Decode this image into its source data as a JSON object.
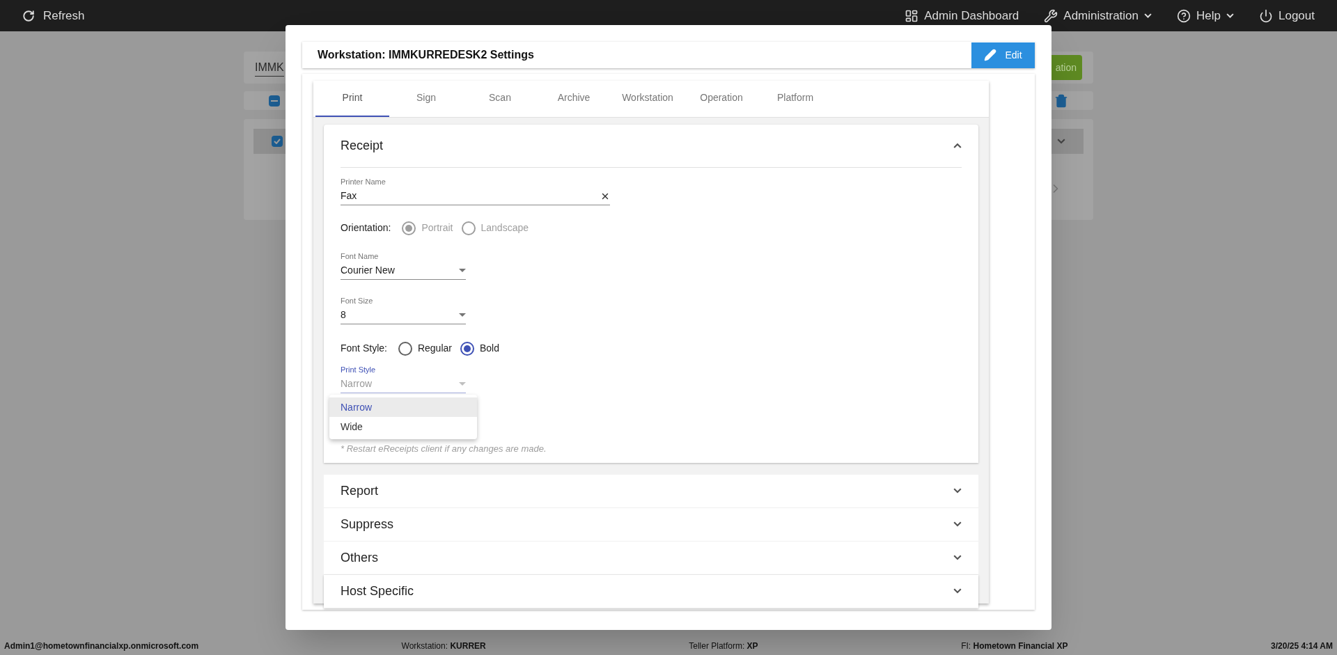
{
  "top_bar": {
    "refresh": "Refresh",
    "items": [
      {
        "label": "Admin Dashboard",
        "dropdown": false
      },
      {
        "label": "Administration",
        "dropdown": true
      },
      {
        "label": "Help",
        "dropdown": true
      },
      {
        "label": "Logout",
        "dropdown": false
      }
    ]
  },
  "background": {
    "search_value": "IMMK",
    "action_button": "ation",
    "select_all": {
      "indeterminate": true
    },
    "row": {
      "checked": true
    }
  },
  "modal": {
    "title": "Workstation: IMMKURREDESK2 Settings",
    "edit_button": "Edit",
    "tabs": [
      {
        "label": "Print",
        "selected": true
      },
      {
        "label": "Sign",
        "selected": false
      },
      {
        "label": "Scan",
        "selected": false
      },
      {
        "label": "Archive",
        "selected": false
      },
      {
        "label": "Workstation",
        "selected": false
      },
      {
        "label": "Operation",
        "selected": false
      },
      {
        "label": "Platform",
        "selected": false
      }
    ],
    "sections": [
      {
        "title": "Receipt",
        "expanded": true
      },
      {
        "title": "Report",
        "expanded": false
      },
      {
        "title": "Suppress",
        "expanded": false
      },
      {
        "title": "Others",
        "expanded": false
      },
      {
        "title": "Host Specific",
        "expanded": false
      }
    ],
    "receipt": {
      "printer_name": {
        "label": "Printer Name",
        "value": "Fax"
      },
      "orientation": {
        "label": "Orientation:",
        "disabled": true,
        "options": [
          {
            "label": "Portrait",
            "selected": true
          },
          {
            "label": "Landscape",
            "selected": false
          }
        ]
      },
      "font_name": {
        "label": "Font Name",
        "value": "Courier New"
      },
      "font_size": {
        "label": "Font Size",
        "value": "8"
      },
      "font_style": {
        "label": "Font Style:",
        "disabled": false,
        "options": [
          {
            "label": "Regular",
            "selected": false
          },
          {
            "label": "Bold",
            "selected": true
          }
        ]
      },
      "print_style": {
        "label": "Print Style",
        "value": "Narrow",
        "open": true,
        "options": [
          {
            "label": "Narrow",
            "selected": true
          },
          {
            "label": "Wide",
            "selected": false
          }
        ]
      },
      "note": "* Restart eReceipts client if any changes are made."
    }
  },
  "status_bar": [
    {
      "value": "Admin1@hometownfinancialxp.onmicrosoft.com"
    },
    {
      "label": "Workstation:",
      "value": "KURRER"
    },
    {
      "label": "Teller Platform:",
      "value": "XP"
    },
    {
      "label": "FI:",
      "value": "Hometown Financial XP"
    },
    {
      "value": "3/20/25 4:14 AM"
    }
  ]
}
